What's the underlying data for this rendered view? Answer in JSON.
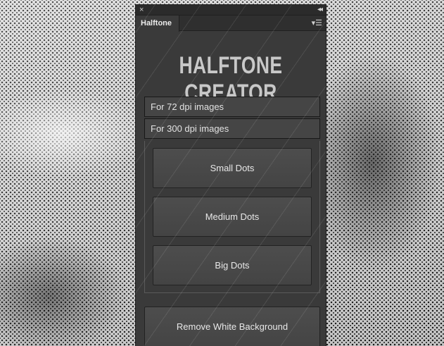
{
  "panel": {
    "close_icon": "×",
    "collapse_icon": "◂◂",
    "menu_icon": "▾☰",
    "tab_label": "Halftone",
    "title": "HALFTONE CREATOR"
  },
  "resolution": {
    "dpi_72_label": "For 72 dpi images",
    "dpi_300_label": "For 300 dpi images"
  },
  "dots": {
    "small_label": "Small Dots",
    "medium_label": "Medium Dots",
    "big_label": "Big Dots"
  },
  "actions": {
    "remove_white_label": "Remove White Background"
  },
  "colors": {
    "panel_bg": "#3a3a3a",
    "button_bg": "#4a4a4a",
    "title_text": "#c8c8c8",
    "label_text": "#e8e8e8"
  }
}
